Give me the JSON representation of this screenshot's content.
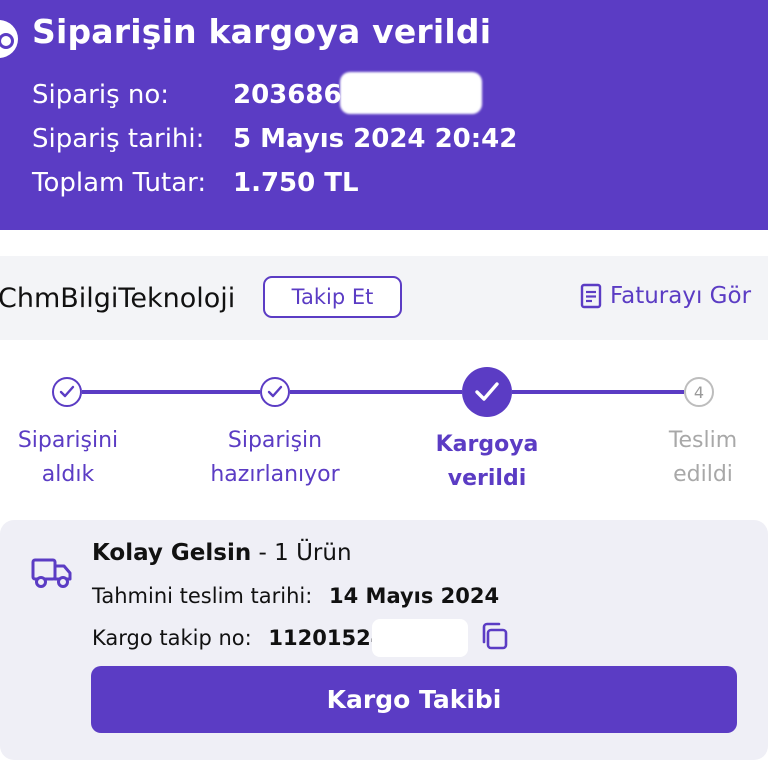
{
  "header": {
    "title": "Siparişin kargoya verildi",
    "order_no_label": "Sipariş no:",
    "order_no_value": "2036866",
    "order_date_label": "Sipariş tarihi:",
    "order_date_value": "5 Mayıs 2024 20:42",
    "total_label": "Toplam Tutar:",
    "total_value": "1.750 TL"
  },
  "seller": {
    "name": "ChmBilgiTeknoloji",
    "follow_label": "Takip Et",
    "invoice_label": "Faturayı Gör"
  },
  "stepper": {
    "steps": [
      {
        "line1": "Siparişini",
        "line2": "aldık",
        "state": "done"
      },
      {
        "line1": "Siparişin",
        "line2": "hazırlanıyor",
        "state": "done"
      },
      {
        "line1": "Kargoya",
        "line2": "verildi",
        "state": "active"
      },
      {
        "line1": "Teslim",
        "line2": "edildi",
        "state": "todo",
        "number": "4"
      }
    ]
  },
  "delivery": {
    "carrier": "Kolay Gelsin",
    "items": "- 1 Ürün",
    "est_label": "Tahmini teslim tarihi:",
    "est_value": "14 Mayıs 2024",
    "tracking_label": "Kargo takip no:",
    "tracking_value": "11201524",
    "cta_label": "Kargo Takibi"
  },
  "colors": {
    "brand": "#5b3cc4",
    "inactive": "#a8a8a8"
  }
}
